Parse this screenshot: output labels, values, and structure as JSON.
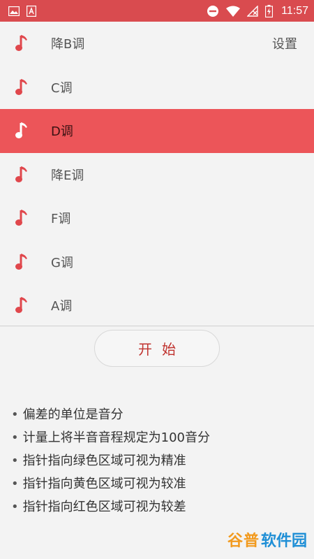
{
  "status_bar": {
    "time": "11:57",
    "bg_color": "#d94b4f",
    "left_icons": [
      "image-icon",
      "text-a-icon"
    ],
    "right_icons": [
      "do-not-disturb-icon",
      "wifi-icon",
      "no-signal-icon",
      "battery-charging-icon"
    ]
  },
  "keys": [
    {
      "label": "降B调",
      "selected": false
    },
    {
      "label": "C调",
      "selected": false
    },
    {
      "label": "D调",
      "selected": true
    },
    {
      "label": "降E调",
      "selected": false
    },
    {
      "label": "F调",
      "selected": false
    },
    {
      "label": "G调",
      "selected": false
    },
    {
      "label": "A调",
      "selected": false
    }
  ],
  "settings_label": "设置",
  "start_label": "开始",
  "notes": [
    "偏差的单位是音分",
    "计量上将半音音程规定为100音分",
    "指针指向绿色区域可视为精准",
    "指针指向黄色区域可视为较准",
    "指针指向红色区域可视为较差"
  ],
  "bullet": "•",
  "watermark": {
    "part1": "谷普",
    "part2": "软件园"
  },
  "colors": {
    "accent": "#ec5559",
    "note_icon": "#e0474c",
    "start_text": "#c0332f"
  }
}
